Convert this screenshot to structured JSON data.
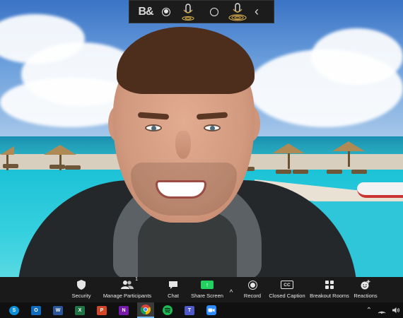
{
  "floating_controls": {
    "logo_text": "B&",
    "caret_icon": "chevron-left-icon"
  },
  "toolbar": {
    "buttons": [
      {
        "label": "Security",
        "icon": "shield-icon"
      },
      {
        "label": "Manage Participants",
        "icon": "participants-icon",
        "count": "1"
      },
      {
        "label": "Chat",
        "icon": "chat-bubble-icon"
      },
      {
        "label": "Share Screen",
        "icon": "share-screen-icon",
        "accent": "#23d160"
      },
      {
        "label": "Record",
        "icon": "record-icon"
      },
      {
        "label": "Closed Caption",
        "icon": "cc-icon",
        "icon_text": "CC"
      },
      {
        "label": "Breakout Rooms",
        "icon": "breakout-rooms-icon"
      },
      {
        "label": "Reactions",
        "icon": "emoji-plus-icon"
      }
    ]
  },
  "taskbar": {
    "apps": [
      {
        "name": "skype",
        "letter": "S",
        "color": "#0a8fd8"
      },
      {
        "name": "outlook",
        "letter": "O",
        "color": "#0f6cbd"
      },
      {
        "name": "word",
        "letter": "W",
        "color": "#2b579a"
      },
      {
        "name": "excel",
        "letter": "X",
        "color": "#217346"
      },
      {
        "name": "powerpoint",
        "letter": "P",
        "color": "#d24726"
      },
      {
        "name": "onenote",
        "letter": "N",
        "color": "#7719aa"
      },
      {
        "name": "chrome",
        "letter": "",
        "color": "#db4437"
      },
      {
        "name": "spotify",
        "letter": "",
        "color": "#1db954"
      },
      {
        "name": "teams",
        "letter": "T",
        "color": "#5059c9"
      },
      {
        "name": "zoom",
        "letter": "",
        "color": "#2d8cff"
      }
    ],
    "active_app": "chrome"
  }
}
